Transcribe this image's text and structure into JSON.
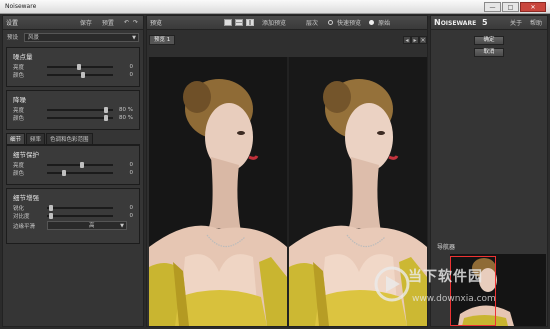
{
  "window": {
    "title": "Noiseware",
    "minimize": "—",
    "maximize": "□",
    "close": "✕"
  },
  "left": {
    "header": "设置",
    "save": "保存",
    "manage": "预置",
    "preset_label": "预设",
    "preset_value": "风景",
    "sections": [
      {
        "title": "噪点量",
        "rows": [
          {
            "name": "亮度",
            "value": "0",
            "level": 0.45
          },
          {
            "name": "颜色",
            "value": "0",
            "level": 0.52
          }
        ]
      },
      {
        "title": "降噪",
        "rows": [
          {
            "name": "亮度",
            "value": "80 %",
            "level": 0.86
          },
          {
            "name": "颜色",
            "value": "80 %",
            "level": 0.86
          }
        ]
      }
    ],
    "tabs": [
      "细节",
      "频率",
      "色调和色彩范围"
    ],
    "detail_sections": [
      {
        "title": "细节保护",
        "rows": [
          {
            "name": "亮度",
            "value": "0",
            "level": 0.5
          },
          {
            "name": "颜色",
            "value": "0",
            "level": 0.22
          }
        ]
      },
      {
        "title": "细节增强",
        "rows": [
          {
            "name": "锐化",
            "value": "0",
            "level": 0.03
          },
          {
            "name": "对比度",
            "value": "0",
            "level": 0.03
          }
        ]
      }
    ],
    "edge_label": "边缘平滑",
    "edge_value": "高"
  },
  "center": {
    "header": "预览",
    "add_preview": "添加预览",
    "layer": "层次",
    "quick_preview": "快速预览",
    "original": "原始",
    "preview_tab": "预览 1",
    "nav_prev": "◂",
    "nav_next": "▸",
    "nav_close": "✕"
  },
  "right": {
    "brand_prefix": "N",
    "brand_small": "OISEWARE",
    "brand_version": "5",
    "about": "关于",
    "help": "帮助",
    "ok": "确定",
    "cancel": "取消",
    "navigator": "导航器"
  },
  "watermark": {
    "line1": "当下软件园",
    "line2": "www.downxia.com"
  },
  "icons": [
    "undo-icon",
    "redo-icon",
    "split-view-icon",
    "radio-icon",
    "chevron-down-icon",
    "app-icon"
  ],
  "colors": {
    "panel": "#353535",
    "background": "#2b2b2b",
    "accent_red": "#e33333",
    "dress": "#c9b530"
  }
}
